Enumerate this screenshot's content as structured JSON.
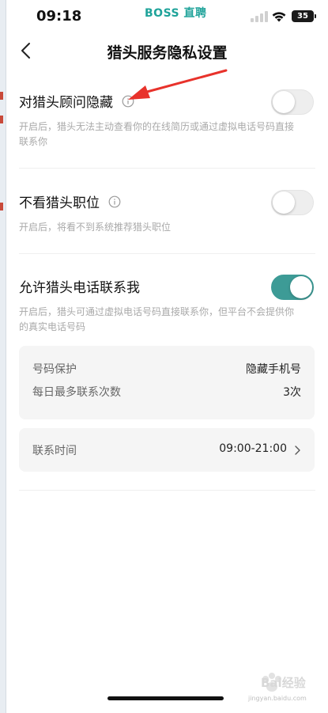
{
  "status_bar": {
    "time": "09:18",
    "brand": "BOSS 直聘",
    "battery": "35"
  },
  "nav": {
    "title": "猎头服务隐私设置"
  },
  "settings": [
    {
      "title": "对猎头顾问隐藏",
      "description": "开启后，猎头无法主动查看你的在线简历或通过虚拟电话号码直接联系你",
      "enabled": false
    },
    {
      "title": "不看猎头职位",
      "description": "开启后，将看不到系统推荐猎头职位",
      "enabled": false
    },
    {
      "title": "允许猎头电话联系我",
      "description": "开启后，猎头可通过虚拟电话号码直接联系你，但平台不会提供你的真实电话号码",
      "enabled": true
    }
  ],
  "phone_card": {
    "rows": [
      {
        "label": "号码保护",
        "value": "隐藏手机号"
      },
      {
        "label": "每日最多联系次数",
        "value": "3次"
      }
    ]
  },
  "contact_time": {
    "label": "联系时间",
    "value": "09:00-21:00"
  },
  "watermark": {
    "text": "Bai经验",
    "sub": "jingyan.baidu.com"
  },
  "colors": {
    "accent": "#3d9b96",
    "brand": "#1fa39a",
    "annotation_arrow": "#e8322b"
  }
}
